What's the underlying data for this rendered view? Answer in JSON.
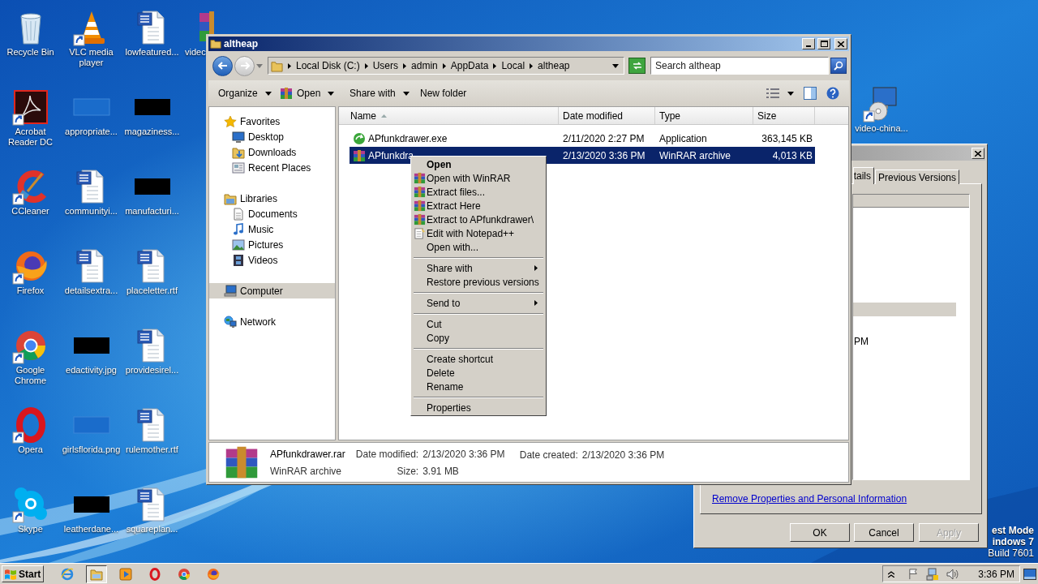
{
  "desktop_icons": [
    {
      "label": "Recycle Bin",
      "kind": "recycle",
      "shortcut": false
    },
    {
      "label": "Acrobat Reader DC",
      "kind": "acrobat",
      "shortcut": true
    },
    {
      "label": "CCleaner",
      "kind": "ccleaner",
      "shortcut": true
    },
    {
      "label": "Firefox",
      "kind": "firefox",
      "shortcut": true
    },
    {
      "label": "Google Chrome",
      "kind": "chrome",
      "shortcut": true
    },
    {
      "label": "Opera",
      "kind": "opera",
      "shortcut": true
    },
    {
      "label": "Skype",
      "kind": "skype",
      "shortcut": true
    },
    {
      "label": "VLC media player",
      "kind": "vlc",
      "shortcut": true
    },
    {
      "label": "appropriate...",
      "kind": "thumb_blank",
      "shortcut": false
    },
    {
      "label": "communityi...",
      "kind": "word",
      "shortcut": false
    },
    {
      "label": "detailsextra...",
      "kind": "word",
      "shortcut": false
    },
    {
      "label": "edactivity.jpg",
      "kind": "thumb_black",
      "shortcut": false
    },
    {
      "label": "girlsflorida.png",
      "kind": "thumb_blank",
      "shortcut": false
    },
    {
      "label": "leatherdane...",
      "kind": "thumb_black",
      "shortcut": false
    },
    {
      "label": "lowfeatured...",
      "kind": "word",
      "shortcut": false
    },
    {
      "label": "magaziness...",
      "kind": "thumb_black",
      "shortcut": false
    },
    {
      "label": "manufacturi...",
      "kind": "thumb_black",
      "shortcut": false
    },
    {
      "label": "placeletter.rtf",
      "kind": "word",
      "shortcut": false
    },
    {
      "label": "providesirel...",
      "kind": "word",
      "shortcut": false
    },
    {
      "label": "rulemother.rtf",
      "kind": "word",
      "shortcut": false
    },
    {
      "label": "squareplan...",
      "kind": "word",
      "shortcut": false
    },
    {
      "label": "videc",
      "kind": "winrar",
      "shortcut": false
    }
  ],
  "desktop_icon_right": {
    "label": "video-china...",
    "kind": "installer",
    "shortcut": true
  },
  "properties_dialog": {
    "tabs": [
      {
        "label": "tails",
        "selected": true
      },
      {
        "label": "Previous Versions",
        "selected": false
      }
    ],
    "list_text": "PM",
    "link": "Remove Properties and Personal Information",
    "buttons": [
      {
        "label": "OK",
        "disabled": false
      },
      {
        "label": "Cancel",
        "disabled": false
      },
      {
        "label": "Apply",
        "disabled": true
      }
    ]
  },
  "explorer": {
    "title": "altheap",
    "address": [
      "Local Disk (C:)",
      "Users",
      "admin",
      "AppData",
      "Local",
      "altheap"
    ],
    "search_placeholder": "Search altheap",
    "toolbar": [
      {
        "label": "Organize",
        "kind": "menu"
      },
      {
        "label": "Open",
        "kind": "open"
      },
      {
        "label": "Share with",
        "kind": "menu"
      },
      {
        "label": "New folder",
        "kind": "plain"
      }
    ],
    "nav_pane": [
      {
        "label": "Favorites",
        "kind": "star",
        "selected": false,
        "children": [
          {
            "label": "Desktop",
            "kind": "desktop",
            "selected": false
          },
          {
            "label": "Downloads",
            "kind": "downloads",
            "selected": false
          },
          {
            "label": "Recent Places",
            "kind": "recent",
            "selected": false
          }
        ]
      },
      {
        "label": "Libraries",
        "kind": "libraries",
        "selected": false,
        "children": [
          {
            "label": "Documents",
            "kind": "documents",
            "selected": false
          },
          {
            "label": "Music",
            "kind": "music",
            "selected": false
          },
          {
            "label": "Pictures",
            "kind": "pictures",
            "selected": false
          },
          {
            "label": "Videos",
            "kind": "videos",
            "selected": false
          }
        ]
      },
      {
        "label": "Computer",
        "kind": "computer",
        "selected": true
      },
      {
        "label": "Network",
        "kind": "network",
        "selected": false
      }
    ],
    "columns": [
      {
        "label": "Name",
        "sorted": true
      },
      {
        "label": "Date modified",
        "sorted": false
      },
      {
        "label": "Type",
        "sorted": false
      },
      {
        "label": "Size",
        "sorted": false
      }
    ],
    "rows": [
      {
        "name": "APfunkdrawer.exe",
        "date": "2/11/2020 2:27 PM",
        "type": "Application",
        "size": "363,145 KB",
        "kind": "exe",
        "selected": false
      },
      {
        "name": "APfunkdra",
        "date": "2/13/2020 3:36 PM",
        "type": "WinRAR archive",
        "size": "4,013 KB",
        "kind": "rar",
        "selected": true
      }
    ],
    "details": {
      "name": "APfunkdrawer.rar",
      "type": "WinRAR archive",
      "fields": [
        {
          "label": "Date modified:",
          "value": "2/13/2020 3:36 PM"
        },
        {
          "label": "Size:",
          "value": "3.91 MB"
        },
        {
          "label": "Date created:",
          "value": "2/13/2020 3:36 PM"
        }
      ]
    }
  },
  "context_menu": [
    {
      "kind": "item",
      "label": "Open",
      "default": true,
      "submenu": false
    },
    {
      "kind": "winrar_item",
      "label": "Open with WinRAR",
      "default": false,
      "submenu": false
    },
    {
      "kind": "winrar_item",
      "label": "Extract files...",
      "default": false,
      "submenu": false
    },
    {
      "kind": "winrar_item",
      "label": "Extract Here",
      "default": false,
      "submenu": false
    },
    {
      "kind": "winrar_item",
      "label": "Extract to APfunkdrawer\\",
      "default": false,
      "submenu": false
    },
    {
      "kind": "notepad_item",
      "label": "Edit with Notepad++",
      "default": false,
      "submenu": false
    },
    {
      "kind": "item",
      "label": "Open with...",
      "default": false,
      "submenu": false
    },
    {
      "kind": "separator"
    },
    {
      "kind": "item",
      "label": "Share with",
      "default": false,
      "submenu": true
    },
    {
      "kind": "item",
      "label": "Restore previous versions",
      "default": false,
      "submenu": false
    },
    {
      "kind": "separator"
    },
    {
      "kind": "item",
      "label": "Send to",
      "default": false,
      "submenu": true
    },
    {
      "kind": "separator"
    },
    {
      "kind": "item",
      "label": "Cut",
      "default": false,
      "submenu": false
    },
    {
      "kind": "item",
      "label": "Copy",
      "default": false,
      "submenu": false
    },
    {
      "kind": "separator"
    },
    {
      "kind": "item",
      "label": "Create shortcut",
      "default": false,
      "submenu": false
    },
    {
      "kind": "item",
      "label": "Delete",
      "default": false,
      "submenu": false
    },
    {
      "kind": "item",
      "label": "Rename",
      "default": false,
      "submenu": false
    },
    {
      "kind": "separator"
    },
    {
      "kind": "item",
      "label": "Properties",
      "default": false,
      "submenu": false
    }
  ],
  "os_notice": [
    "est Mode",
    "indows 7",
    "Build 7601"
  ],
  "taskbar": {
    "start": "Start",
    "quick_launch": [
      {
        "kind": "ie",
        "active": false
      },
      {
        "kind": "explorer",
        "active": true
      },
      {
        "kind": "media",
        "active": false
      },
      {
        "kind": "opera",
        "active": false
      },
      {
        "kind": "chrome",
        "active": false
      },
      {
        "kind": "firefox",
        "active": false
      }
    ],
    "clock": "3:36 PM"
  }
}
